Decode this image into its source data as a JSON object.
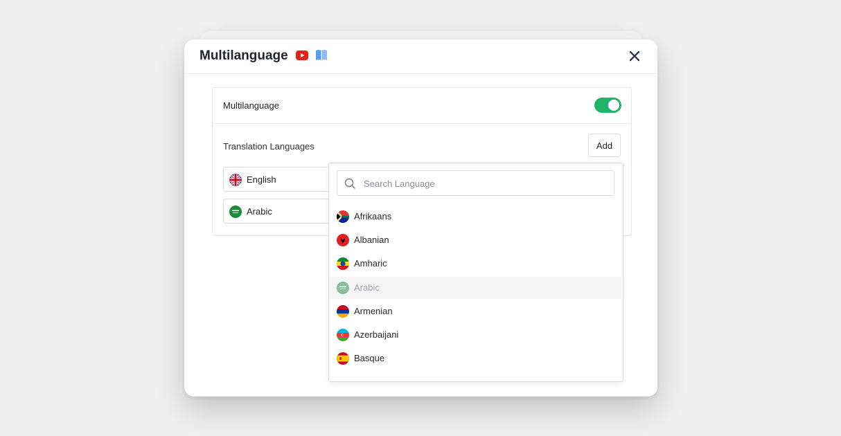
{
  "modal": {
    "title": "Multilanguage",
    "header_icons": [
      "youtube-icon",
      "book-icon",
      "close-icon"
    ]
  },
  "settings": {
    "multilanguage_label": "Multilanguage",
    "multilanguage_enabled": true,
    "translation_label": "Translation Languages",
    "add_label": "Add",
    "selected_languages": [
      {
        "name": "English",
        "flag": "uk-flag-icon"
      },
      {
        "name": "Arabic",
        "flag": "saudi-flag-icon"
      }
    ]
  },
  "dropdown": {
    "search_placeholder": "Search Language",
    "options": [
      {
        "name": "Afrikaans",
        "flag": "south-africa-flag-icon",
        "disabled": false
      },
      {
        "name": "Albanian",
        "flag": "albania-flag-icon",
        "disabled": false
      },
      {
        "name": "Amharic",
        "flag": "ethiopia-flag-icon",
        "disabled": false
      },
      {
        "name": "Arabic",
        "flag": "saudi-flag-icon",
        "disabled": true
      },
      {
        "name": "Armenian",
        "flag": "armenia-flag-icon",
        "disabled": false
      },
      {
        "name": "Azerbaijani",
        "flag": "azerbaijan-flag-icon",
        "disabled": false
      },
      {
        "name": "Basque",
        "flag": "spain-flag-icon",
        "disabled": false
      }
    ]
  },
  "colors": {
    "toggle_on": "#22b36a",
    "youtube_red": "#e62117",
    "book_blue": "#5b9bf0"
  }
}
